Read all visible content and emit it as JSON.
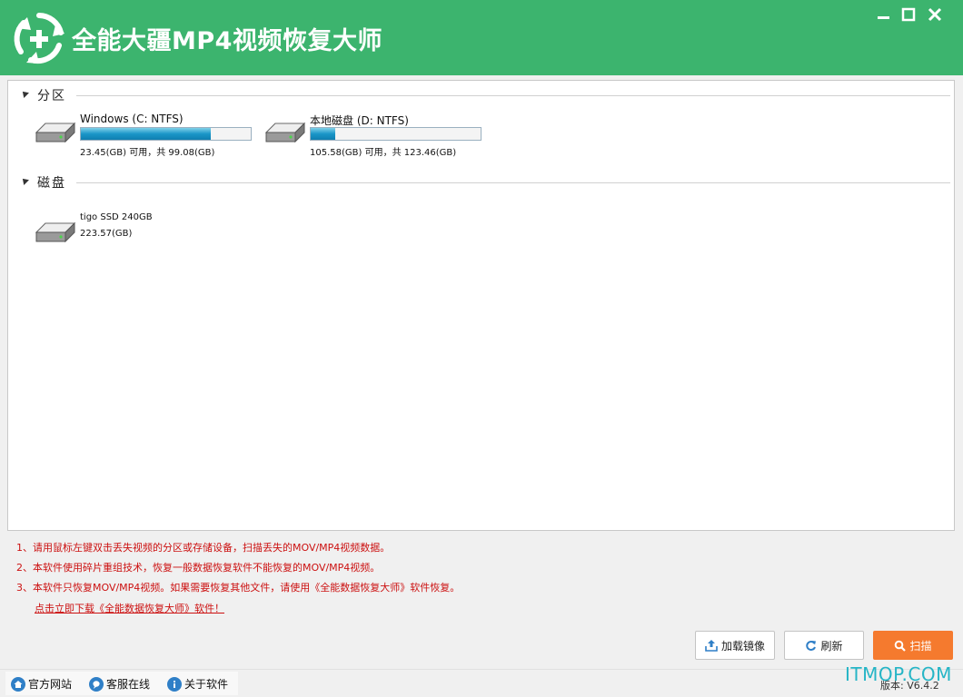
{
  "titlebar": {
    "title": "全能大疆MP4视频恢复大师",
    "brand_color": "#3cb46e",
    "logo_icon": "recycle-plus-icon",
    "window_buttons": [
      "minimize-icon",
      "maximize-icon",
      "close-icon"
    ]
  },
  "groups": {
    "partitions": {
      "label": "分区",
      "drives": [
        {
          "name": "Windows (C: NTFS)",
          "info": "23.45(GB) 可用，共 99.08(GB)",
          "used_fraction": 0.763
        },
        {
          "name": "本地磁盘 (D: NTFS)",
          "info": "105.58(GB) 可用，共 123.46(GB)",
          "used_fraction": 0.145
        }
      ]
    },
    "disks": {
      "label": "磁盘",
      "drives": [
        {
          "name": "tigo SSD 240GB",
          "info": "223.57(GB)"
        }
      ]
    }
  },
  "tips": {
    "items": [
      "1、请用鼠标左键双击丢失视频的分区或存储设备，扫描丢失的MOV/MP4视频数据。",
      "2、本软件使用碎片重组技术，恢复一般数据恢复软件不能恢复的MOV/MP4视频。",
      "3、本软件只恢复MOV/MP4视频。如果需要恢复其他文件，请使用《全能数据恢复大师》软件恢复。"
    ],
    "link": "点击立即下载《全能数据恢复大师》软件！",
    "color": "#cc1111"
  },
  "buttons": {
    "load_image": "加载镜像",
    "refresh": "刷新",
    "scan": "扫描",
    "scan_color": "#f57a2e"
  },
  "footer": {
    "official_site": "官方网站",
    "customer_service": "客服在线",
    "about": "关于软件",
    "version": "版本: V6.4.2"
  },
  "watermark": "ITMOP.COM"
}
